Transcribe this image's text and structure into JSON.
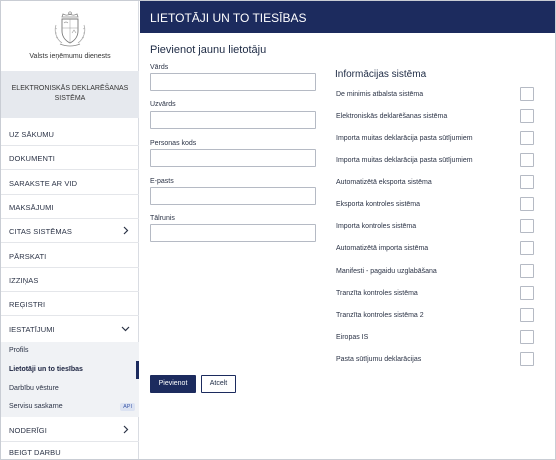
{
  "brand": {
    "org_name": "Valsts ieņēmumu dienests",
    "system_name": "ELEKTRONISKĀS DEKLARĒŠANAS SISTĒMA",
    "logo_icon": "coat-of-arms-icon"
  },
  "sidebar": {
    "items": [
      {
        "label": "UZ SĀKUMU"
      },
      {
        "label": "DOKUMENTI"
      },
      {
        "label": "SARAKSTE AR VID"
      },
      {
        "label": "MAKSĀJUMI"
      },
      {
        "label": "CITAS SISTĒMAS",
        "icon": "chevron-right-icon"
      },
      {
        "label": "PĀRSKATI"
      },
      {
        "label": "IZZIŅAS"
      },
      {
        "label": "REĢISTRI"
      },
      {
        "label": "IESTATĪJUMI",
        "icon": "chevron-down-icon"
      }
    ],
    "sub_items": [
      {
        "label": "Profils"
      },
      {
        "label": "Lietotāji un to tiesības",
        "active": true
      },
      {
        "label": "Darbību vēsture"
      },
      {
        "label": "Servisu saskarne",
        "badge": "API"
      }
    ],
    "bottom_items": [
      {
        "label": "NODERĪGI",
        "icon": "chevron-right-icon"
      },
      {
        "label": "BEIGT DARBU"
      }
    ]
  },
  "header": {
    "title": "LIETOTĀJI UN TO TIESĪBAS"
  },
  "form": {
    "title": "Pievienot jaunu lietotāju",
    "fields": [
      {
        "label": "Vārds",
        "value": ""
      },
      {
        "label": "Uzvārds",
        "value": ""
      },
      {
        "label": "Personas kods",
        "value": ""
      },
      {
        "label": "E-pasts",
        "value": ""
      },
      {
        "label": "Tālrunis",
        "value": ""
      }
    ],
    "info_systems_title": "Informācijas sistēma",
    "info_systems": [
      {
        "label": "De minimis atbalsta sistēma",
        "checked": false
      },
      {
        "label": "Elektroniskās deklarēšanas sistēma",
        "checked": false
      },
      {
        "label": "Importa muitas deklarācija pasta sūtījumiem",
        "checked": false
      },
      {
        "label": "Importa muitas deklarācija pasta sūtījumiem",
        "checked": false
      },
      {
        "label": "Automatizētā eksporta sistēma",
        "checked": false
      },
      {
        "label": "Eksporta kontroles sistēma",
        "checked": false
      },
      {
        "label": "Importa kontroles sistēma",
        "checked": false
      },
      {
        "label": "Automatizētā importa sistēma",
        "checked": false
      },
      {
        "label": "Manifesti - pagaidu uzglabāšana",
        "checked": false
      },
      {
        "label": "Tranzīta kontroles sistēma",
        "checked": false
      },
      {
        "label": "Tranzīta kontroles sistēma 2",
        "checked": false
      },
      {
        "label": "Eiropas IS",
        "checked": false
      },
      {
        "label": "Pasta sūtījumu deklarācijas",
        "checked": false
      }
    ],
    "submit_label": "Pievienot",
    "cancel_label": "Atcelt"
  },
  "colors": {
    "primary": "#1c2b5e",
    "sidebar_highlight": "#e6e9ee",
    "submenu_bg": "#f0f2f5",
    "border": "#b5bac4"
  }
}
